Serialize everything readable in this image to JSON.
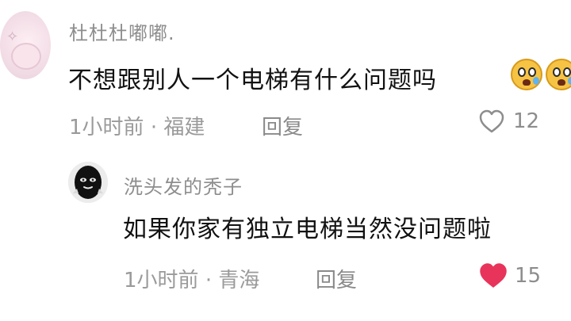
{
  "comments": [
    {
      "username": "杜杜杜嘟嘟.",
      "text": "不想跟别人一个电梯有什么问题吗",
      "time": "1小时前",
      "separator": "·",
      "location": "福建",
      "reply_label": "回复",
      "likes": "12",
      "liked": false,
      "emoji": "crying-face-emoji"
    },
    {
      "username": "洗头发的秃子",
      "text": "如果你家有独立电梯当然没问题啦",
      "time": "1小时前",
      "separator": "·",
      "location": "青海",
      "reply_label": "回复",
      "likes": "15",
      "liked": true
    }
  ],
  "colors": {
    "liked_heart": "#e8345a",
    "unliked_heart_stroke": "#8d8d8d",
    "username": "#8d8d8d",
    "meta": "#9a9a9a",
    "content": "#111111"
  },
  "icons": {
    "like": "heart-icon",
    "avatar1": "anime-avatar",
    "avatar2": "balaclava-avatar"
  }
}
